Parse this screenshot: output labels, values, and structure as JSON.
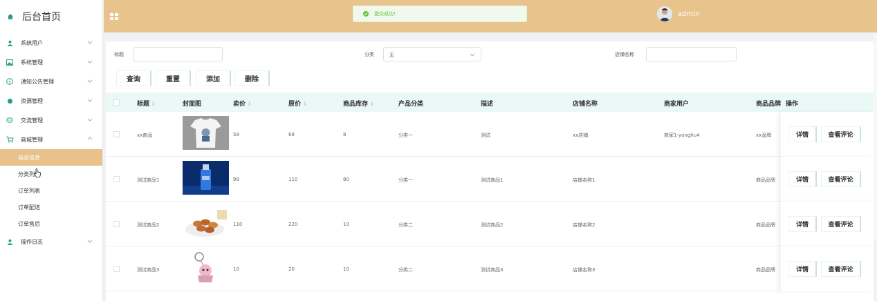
{
  "brand": {
    "title": "后台首页"
  },
  "sidebar": {
    "items": [
      {
        "label": "系统用户",
        "icon": "user-icon"
      },
      {
        "label": "系统管理",
        "icon": "image-icon"
      },
      {
        "label": "通知公告管理",
        "icon": "info-icon"
      },
      {
        "label": "资源管理",
        "icon": "drop-icon"
      },
      {
        "label": "交流管理",
        "icon": "chat-icon"
      },
      {
        "label": "商城管理",
        "icon": "cart-icon"
      }
    ],
    "subitems": [
      "商品信息",
      "分类列表",
      "订单列表",
      "订单配送",
      "订单售后"
    ],
    "last_item": {
      "label": "操作日志",
      "icon": "user-icon"
    }
  },
  "header": {
    "toast": "提交成功!",
    "username": "admin",
    "accent": "#e9c38c"
  },
  "filters": {
    "title_label": "标题",
    "category_label": "分类",
    "category_value": "无",
    "store_label": "店铺名称"
  },
  "buttons": {
    "query": "查询",
    "reset": "重置",
    "add": "添加",
    "delete": "删除"
  },
  "table": {
    "headers": [
      "标题",
      "封面图",
      "卖价",
      "原价",
      "商品库存",
      "产品分类",
      "描述",
      "店铺名称",
      "商家用户",
      "商品品牌",
      "操作"
    ],
    "rows": [
      {
        "title": "xx商品",
        "price": "58",
        "orig": "68",
        "stock": "8",
        "category": "分类一",
        "desc": "测试",
        "store": "xx店铺",
        "merchant": "商家1-yonghu4",
        "brand": "xx品牌"
      },
      {
        "title": "测试商品1",
        "price": "99",
        "orig": "110",
        "stock": "80",
        "category": "分类一",
        "desc": "测试商品1",
        "store": "店铺名称1",
        "merchant": "",
        "brand": "商品品牌"
      },
      {
        "title": "测试商品2",
        "price": "110",
        "orig": "220",
        "stock": "10",
        "category": "分类二",
        "desc": "测试商品2",
        "store": "店铺名称2",
        "merchant": "",
        "brand": "商品品牌"
      },
      {
        "title": "测试商品3",
        "price": "10",
        "orig": "20",
        "stock": "10",
        "category": "分类二",
        "desc": "测试商品3",
        "store": "店铺名称3",
        "merchant": "",
        "brand": "商品品牌"
      }
    ],
    "detail_label": "详情",
    "review_label": "查看评论"
  }
}
